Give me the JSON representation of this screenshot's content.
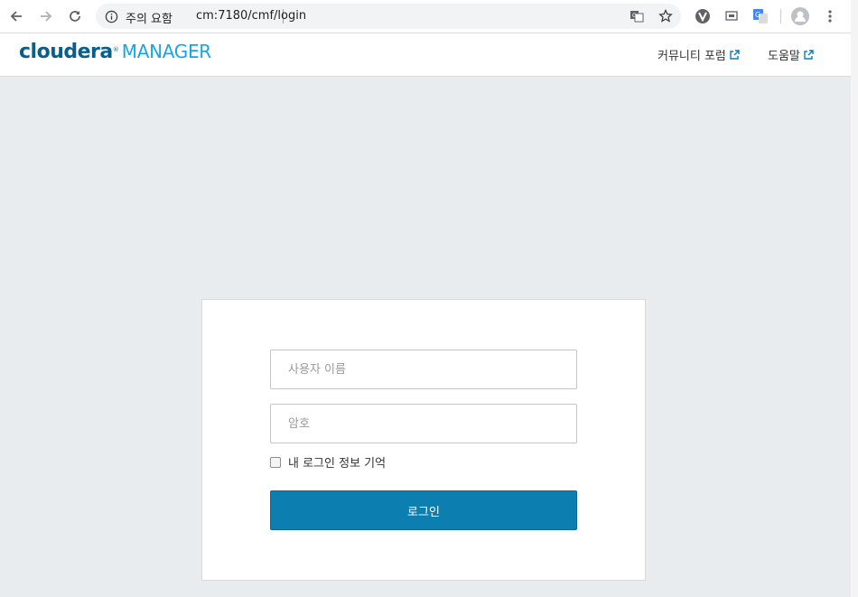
{
  "browser": {
    "security_label": "주의 요함",
    "url": "cm:7180/cmf/login",
    "icons": [
      "back-icon",
      "forward-icon",
      "reload-icon",
      "info-icon",
      "translate-icon",
      "star-icon",
      "extension-v-icon",
      "extension-cast-icon",
      "extension-google-translate-icon",
      "profile-icon",
      "menu-icon"
    ]
  },
  "header": {
    "logo_brand": "cloudera",
    "logo_product": "MANAGER",
    "links": [
      {
        "label": "커뮤니티 포럼"
      },
      {
        "label": "도움말"
      }
    ]
  },
  "login": {
    "username_placeholder": "사용자 이름",
    "password_placeholder": "암호",
    "remember_label": "내 로그인 정보 기억",
    "submit_label": "로그인"
  },
  "colors": {
    "brand_dark": "#0a5f8a",
    "brand_light": "#19a5e0",
    "button": "#0d7eb0",
    "page_bg": "#e9ecef"
  }
}
